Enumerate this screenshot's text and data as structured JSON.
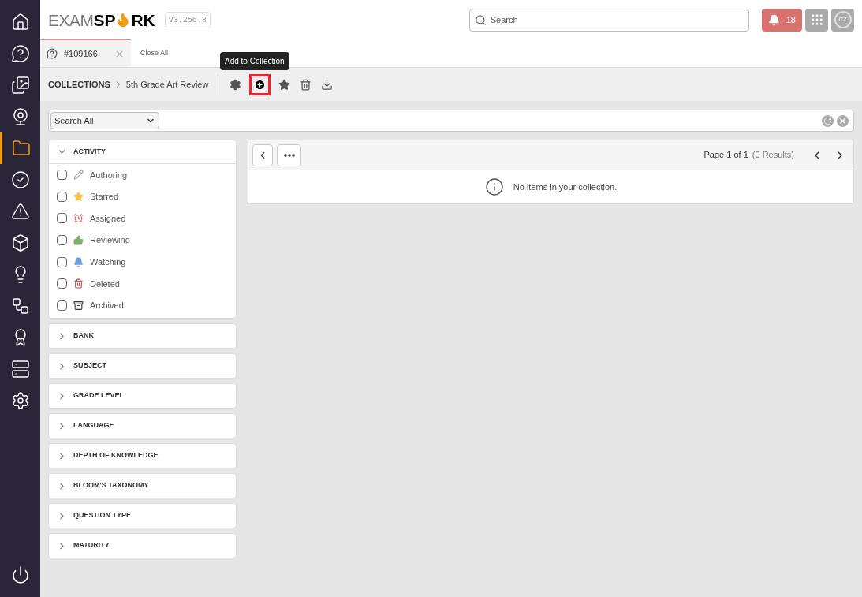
{
  "nav": [
    {
      "kind": "home",
      "selected": false
    },
    {
      "kind": "question",
      "selected": false
    },
    {
      "kind": "images",
      "selected": false
    },
    {
      "kind": "webcam",
      "selected": false
    },
    {
      "kind": "folder",
      "selected": true
    },
    {
      "kind": "check",
      "selected": false
    },
    {
      "kind": "alert",
      "selected": false
    },
    {
      "kind": "box",
      "selected": false
    },
    {
      "kind": "bulb",
      "selected": false
    },
    {
      "kind": "workflow",
      "selected": false
    },
    {
      "kind": "award",
      "selected": false
    },
    {
      "kind": "server",
      "selected": false
    },
    {
      "kind": "settings",
      "selected": false
    }
  ],
  "logo": {
    "light": "EXAM",
    "bold_start": "SP",
    "bold_end": "RK"
  },
  "version": "v3.256.3",
  "search": {
    "placeholder": "Search"
  },
  "notifications": {
    "count": "18"
  },
  "avatar": "CZ",
  "tabs": [
    {
      "label": "#109166",
      "selected": true
    }
  ],
  "close_all": "Close All",
  "breadcrumb": [
    "COLLECTIONS",
    "5th Grade Art Review"
  ],
  "tooltip": "Add to Collection",
  "search_scope": "Search All",
  "filters": [
    {
      "title": "ACTIVITY",
      "expanded": true,
      "items": [
        {
          "kind": "pencil",
          "label": "Authoring",
          "checked": false
        },
        {
          "kind": "star",
          "label": "Starred",
          "checked": false
        },
        {
          "kind": "alarm",
          "label": "Assigned",
          "checked": false
        },
        {
          "kind": "thumb",
          "label": "Reviewing",
          "checked": false
        },
        {
          "kind": "bell",
          "label": "Watching",
          "checked": false
        },
        {
          "kind": "trash",
          "label": "Deleted",
          "checked": false
        },
        {
          "kind": "archive",
          "label": "Archived",
          "checked": false
        }
      ]
    },
    {
      "title": "BANK",
      "expanded": false
    },
    {
      "title": "SUBJECT",
      "expanded": false
    },
    {
      "title": "GRADE LEVEL",
      "expanded": false
    },
    {
      "title": "LANGUAGE",
      "expanded": false
    },
    {
      "title": "DEPTH OF KNOWLEDGE",
      "expanded": false
    },
    {
      "title": "BLOOM'S TAXONOMY",
      "expanded": false
    },
    {
      "title": "QUESTION TYPE",
      "expanded": false
    },
    {
      "title": "MATURITY",
      "expanded": false
    }
  ],
  "pager": {
    "page": "Page 1 of 1",
    "results": "(0 Results)"
  },
  "empty_message": "No items in your collection."
}
